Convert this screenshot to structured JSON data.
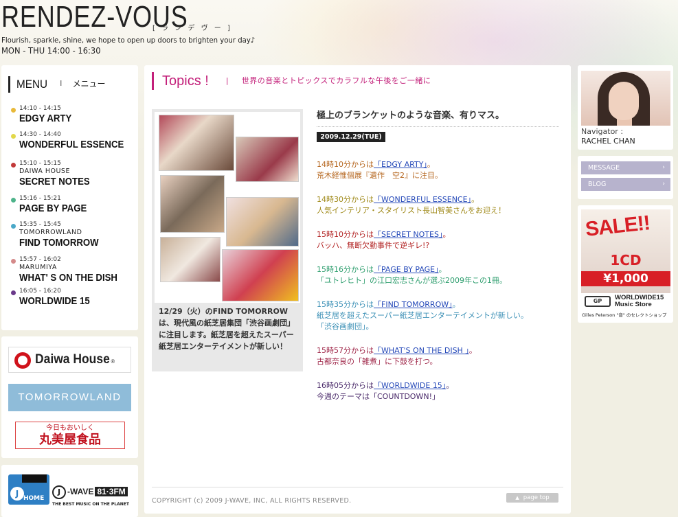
{
  "header": {
    "title": "RENDEZ-VOUS",
    "kana": "[ ラ ン デ ヴ ー ]",
    "tagline": "Flourish, sparkle, shine, we hope to open up doors to brighten your day♪",
    "schedule": "MON - THU 14:00 - 16:30"
  },
  "menu": {
    "title": "MENU",
    "separator": "I",
    "title_ja": "メニュー",
    "items": [
      {
        "time": "14:10 - 14:15",
        "sponsor": "",
        "name": "EDGY ARTY",
        "color": "#e8b93a"
      },
      {
        "time": "14:30 - 14:40",
        "sponsor": "",
        "name": "WONDERFUL ESSENCE",
        "color": "#e2d84a"
      },
      {
        "time": "15:10 - 15:15",
        "sponsor": "DAIWA HOUSE",
        "name": "SECRET NOTES",
        "color": "#c23a3a"
      },
      {
        "time": "15:16 - 15:21",
        "sponsor": "",
        "name": "PAGE BY PAGE",
        "color": "#4db38a"
      },
      {
        "time": "15:35 - 15:45",
        "sponsor": "TOMORROWLAND",
        "name": "FIND TOMORROW",
        "color": "#4aa8c8"
      },
      {
        "time": "15:57 - 16:02",
        "sponsor": "MARUMIYA",
        "name": "WHAT' S ON THE DISH",
        "color": "#d48a8a"
      },
      {
        "time": "16:05 - 16:20",
        "sponsor": "",
        "name": "WORLDWIDE 15",
        "color": "#6a3a8a"
      }
    ]
  },
  "sponsors": {
    "daiwa": "Daiwa House",
    "daiwa_mark": "®",
    "tomorrowland": "TOMORROWLAND",
    "marumiya_small": "今日もおいしく",
    "marumiya_big": "丸美屋食品"
  },
  "home": {
    "label": "HOME",
    "j_letter": "J",
    "jwave": "-WAVE",
    "freq": "81·3FM",
    "jwave_sub": "THE BEST MUSIC ON THE PLANET"
  },
  "topics": {
    "title": "Topics !",
    "bar": "|",
    "subtitle": "世界の音楽とトピックスでカラフルな午後をご一緒に",
    "photo_caption": "12/29（火）のFIND TOMORROWは、現代風の紙芝居集団「渋谷画劇団」に注目します。紙芝居を超えたスーパー紙芝居エンターテイメントが新しい！",
    "article_title": "極上のブランケットのような音楽、有りマス。",
    "date": "2009.12.29(TUE)",
    "entries": [
      {
        "prefix": "14時10分からは",
        "link": "「EDGY ARTY」",
        "suffix": "。",
        "desc": "荒木経惟個展『遺作　空2』に注目。",
        "color": "#b5651d"
      },
      {
        "prefix": "14時30分からは",
        "link": "「WONDERFUL ESSENCE」",
        "suffix": "。",
        "desc": "人気インテリア・スタイリスト長山智美さんをお迎え！",
        "color": "#a08a1a"
      },
      {
        "prefix": "15時10分からは",
        "link": "「SECRET NOTES」",
        "suffix": "。",
        "desc": "バッハ、無断欠勤事件で逆ギレ!?",
        "color": "#b22222"
      },
      {
        "prefix": "15時16分からは",
        "link": "「PAGE BY PAGE」",
        "suffix": "。",
        "desc": "「ユトレヒト」の江口宏志さんが選ぶ2009年この1冊。",
        "color": "#2e9e6e"
      },
      {
        "prefix": "15時35分からは",
        "link": "「FIND TOMORROW」",
        "suffix": "。",
        "desc": "紙芝居を超えたスーパー紙芝居エンターテイメントが新しい。「渋谷画劇団」。",
        "color": "#3a8fb5"
      },
      {
        "prefix": "15時57分からは",
        "link": "「WHAT'S ON THE DISH 」",
        "suffix": "。",
        "desc": "古都奈良の「雑煮」に下鼓を打つ。",
        "color": "#a0284a"
      },
      {
        "prefix": "16時05分からは",
        "link": "「WORLDWIDE 15」",
        "suffix": "。",
        "desc": "今週のテーマは「COUNTDOWN!」",
        "color": "#4a2a6a"
      }
    ],
    "copyright": "COPYRIGHT (c) 2009 J-WAVE, INC, ALL RIGHTS RESERVED.",
    "pagetop": "page top",
    "pagetop_arrow": "▲"
  },
  "navigator": {
    "label": "Navigator :",
    "name": "RACHEL CHAN"
  },
  "links": {
    "message": "MESSAGE",
    "blog": "BLOG",
    "arrow": "›"
  },
  "ad": {
    "sale": "SALE!!",
    "cd": "1CD",
    "price": "¥1,000",
    "store_mark": "GP",
    "store_name_1": "WORLDWIDE15",
    "store_name_2": "Music Store",
    "caption": "Gilles Peterson \"音\" のセレクトショップ"
  }
}
